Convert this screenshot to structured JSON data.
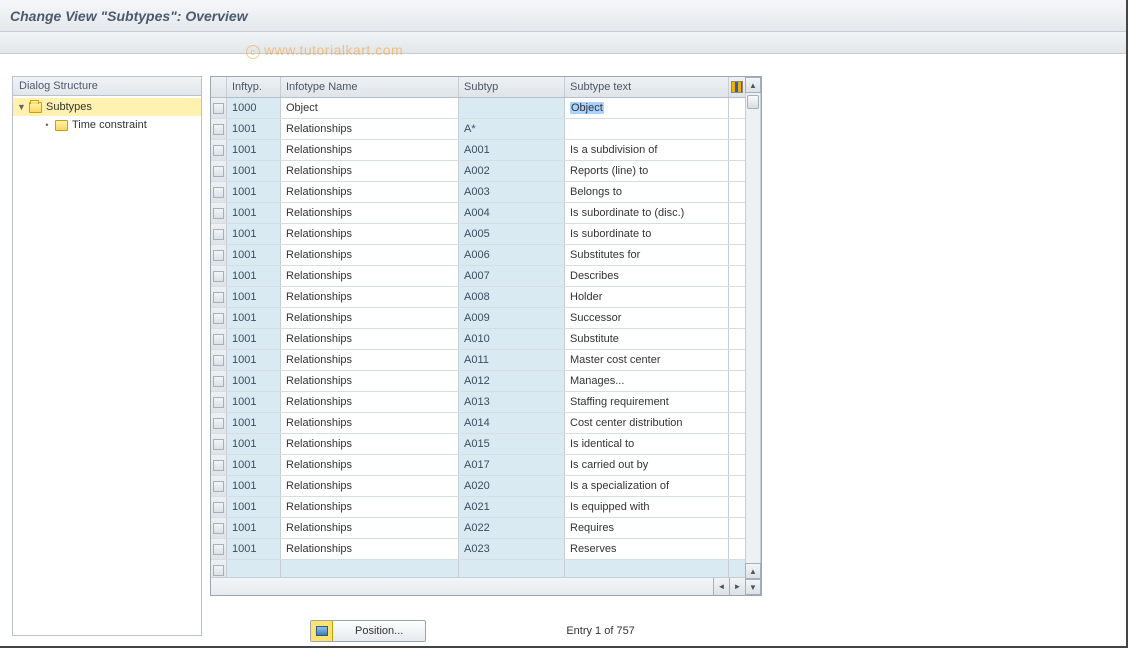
{
  "title": "Change View \"Subtypes\": Overview",
  "watermark": "www.tutorialkart.com",
  "sidebar": {
    "header": "Dialog Structure",
    "items": [
      {
        "label": "Subtypes",
        "selected": true,
        "hasChildren": true
      },
      {
        "label": "Time constraint",
        "selected": false,
        "hasChildren": false
      }
    ]
  },
  "table": {
    "headers": {
      "infty": "Inftyp.",
      "itname": "Infotype Name",
      "subty": "Subtyp",
      "stxt": "Subtype text"
    },
    "rows": [
      {
        "infty": "1000",
        "itname": "Object",
        "subty": "",
        "stxt": "Object",
        "highlight": true
      },
      {
        "infty": "1001",
        "itname": "Relationships",
        "subty": "A*",
        "stxt": ""
      },
      {
        "infty": "1001",
        "itname": "Relationships",
        "subty": "A001",
        "stxt": "Is a subdivision of"
      },
      {
        "infty": "1001",
        "itname": "Relationships",
        "subty": "A002",
        "stxt": "Reports (line) to"
      },
      {
        "infty": "1001",
        "itname": "Relationships",
        "subty": "A003",
        "stxt": "Belongs to"
      },
      {
        "infty": "1001",
        "itname": "Relationships",
        "subty": "A004",
        "stxt": "Is subordinate to (disc.)"
      },
      {
        "infty": "1001",
        "itname": "Relationships",
        "subty": "A005",
        "stxt": "Is subordinate to"
      },
      {
        "infty": "1001",
        "itname": "Relationships",
        "subty": "A006",
        "stxt": "Substitutes for"
      },
      {
        "infty": "1001",
        "itname": "Relationships",
        "subty": "A007",
        "stxt": "Describes"
      },
      {
        "infty": "1001",
        "itname": "Relationships",
        "subty": "A008",
        "stxt": "Holder"
      },
      {
        "infty": "1001",
        "itname": "Relationships",
        "subty": "A009",
        "stxt": "Successor"
      },
      {
        "infty": "1001",
        "itname": "Relationships",
        "subty": "A010",
        "stxt": "Substitute"
      },
      {
        "infty": "1001",
        "itname": "Relationships",
        "subty": "A011",
        "stxt": "Master cost center"
      },
      {
        "infty": "1001",
        "itname": "Relationships",
        "subty": "A012",
        "stxt": "Manages..."
      },
      {
        "infty": "1001",
        "itname": "Relationships",
        "subty": "A013",
        "stxt": "Staffing requirement"
      },
      {
        "infty": "1001",
        "itname": "Relationships",
        "subty": "A014",
        "stxt": "Cost center distribution"
      },
      {
        "infty": "1001",
        "itname": "Relationships",
        "subty": "A015",
        "stxt": "Is identical to"
      },
      {
        "infty": "1001",
        "itname": "Relationships",
        "subty": "A017",
        "stxt": "Is carried out by"
      },
      {
        "infty": "1001",
        "itname": "Relationships",
        "subty": "A020",
        "stxt": "Is a specialization of"
      },
      {
        "infty": "1001",
        "itname": "Relationships",
        "subty": "A021",
        "stxt": "Is equipped with"
      },
      {
        "infty": "1001",
        "itname": "Relationships",
        "subty": "A022",
        "stxt": "Requires"
      },
      {
        "infty": "1001",
        "itname": "Relationships",
        "subty": "A023",
        "stxt": "Reserves"
      }
    ]
  },
  "footer": {
    "position_button": "Position...",
    "entry_info": "Entry 1 of 757"
  }
}
